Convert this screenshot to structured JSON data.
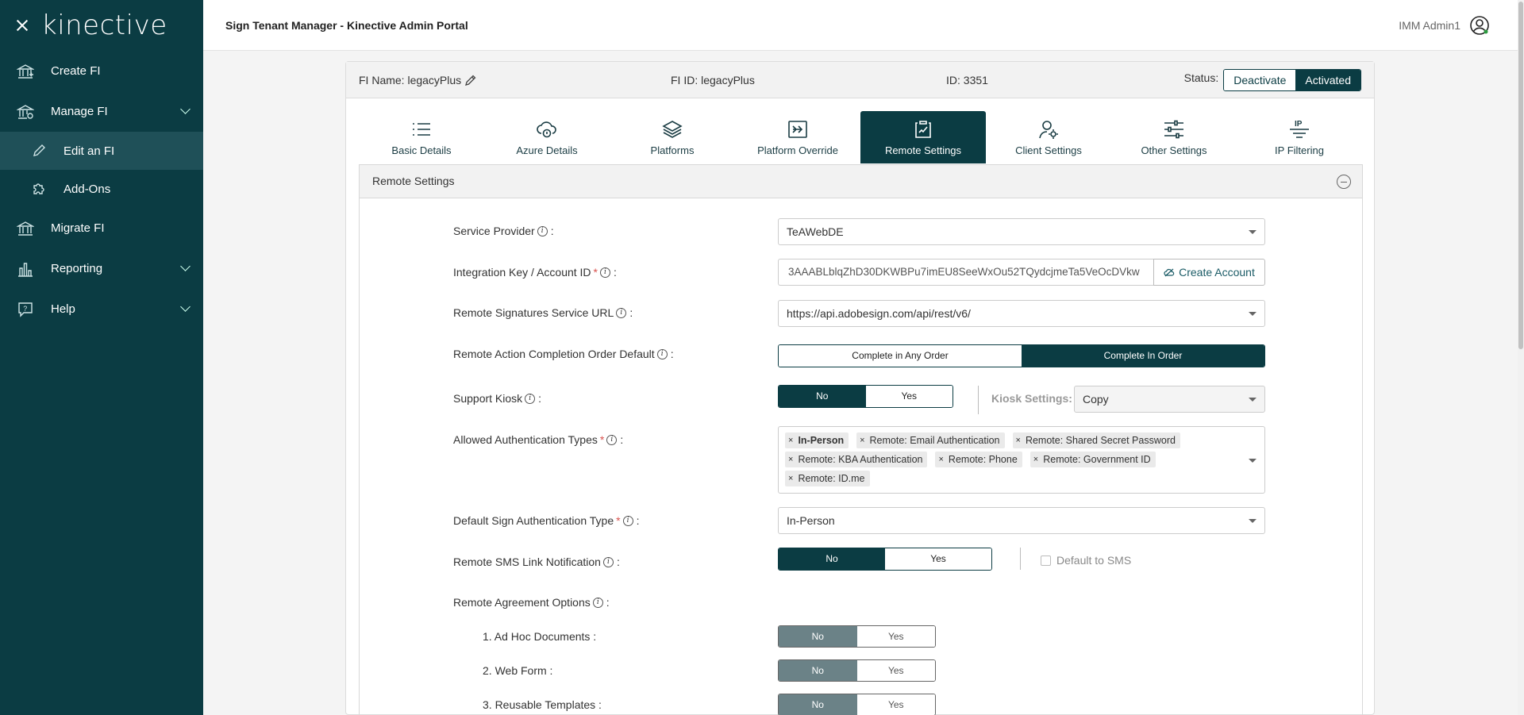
{
  "sidebar": {
    "logo": "kinective",
    "items": [
      {
        "label": "Create FI"
      },
      {
        "label": "Manage FI"
      },
      {
        "label": "Edit an FI"
      },
      {
        "label": "Add-Ons"
      },
      {
        "label": "Migrate FI"
      },
      {
        "label": "Reporting"
      },
      {
        "label": "Help"
      }
    ]
  },
  "header": {
    "title": "Sign Tenant Manager - Kinective Admin Portal",
    "user": "IMM Admin1"
  },
  "fi": {
    "name": "FI Name: legacyPlus",
    "fi_id": "FI ID: legacyPlus",
    "id": "ID: 3351",
    "status_label": "Status:",
    "deactivate": "Deactivate",
    "activated": "Activated"
  },
  "tabs": [
    {
      "label": "Basic Details"
    },
    {
      "label": "Azure Details"
    },
    {
      "label": "Platforms"
    },
    {
      "label": "Platform Override"
    },
    {
      "label": "Remote Settings"
    },
    {
      "label": "Client Settings"
    },
    {
      "label": "Other Settings"
    },
    {
      "label": "IP Filtering"
    }
  ],
  "section": {
    "title": "Remote Settings",
    "service_provider": {
      "label": "Service Provider",
      "value": "TeAWebDE"
    },
    "integration_key": {
      "label": "Integration Key / Account ID",
      "value": "3AAABLblqZhD30DKWBPu7imEU8SeeWxOu52TQydcjmeTa5VeOcDVkw",
      "button": "Create Account"
    },
    "service_url": {
      "label": "Remote Signatures Service URL",
      "value": "https://api.adobesign.com/api/rest/v6/"
    },
    "completion_order": {
      "label": "Remote Action Completion Order Default",
      "opt1": "Complete in Any Order",
      "opt2": "Complete In Order"
    },
    "support_kiosk": {
      "label": "Support Kiosk",
      "no": "No",
      "yes": "Yes",
      "kiosk_label": "Kiosk Settings:",
      "kiosk_value": "Copy"
    },
    "auth_types": {
      "label": "Allowed Authentication Types",
      "tags": [
        "In-Person",
        "Remote: Email Authentication",
        "Remote: Shared Secret Password",
        "Remote: KBA Authentication",
        "Remote: Phone",
        "Remote: Government ID",
        "Remote: ID.me"
      ]
    },
    "default_auth": {
      "label": "Default Sign Authentication Type",
      "value": "In-Person"
    },
    "sms_notification": {
      "label": "Remote SMS Link Notification",
      "no": "No",
      "yes": "Yes",
      "default_sms": "Default to SMS"
    },
    "agreement_options": {
      "label": "Remote Agreement Options"
    },
    "options": [
      {
        "label": "1. Ad Hoc Documents :",
        "no": "No",
        "yes": "Yes"
      },
      {
        "label": "2. Web Form :",
        "no": "No",
        "yes": "Yes"
      },
      {
        "label": "3. Reusable Templates :",
        "no": "No",
        "yes": "Yes"
      }
    ]
  },
  "colors": {
    "primary": "#0b3c43",
    "accent_sub": "#1f5058"
  }
}
